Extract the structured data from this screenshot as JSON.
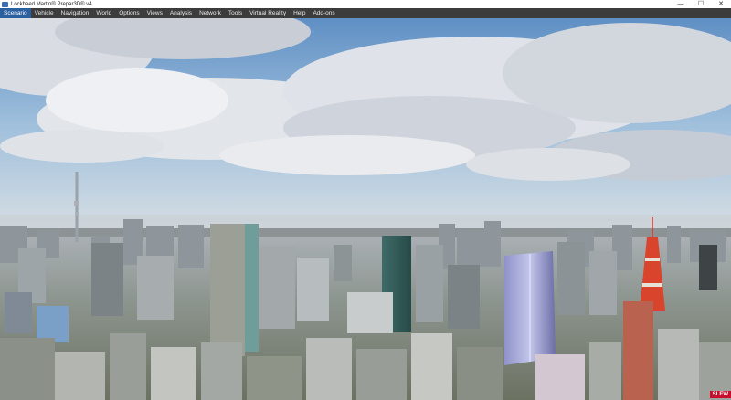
{
  "window": {
    "title": "Lockheed Martin® Prepar3D® v4",
    "controls": {
      "minimize": "—",
      "maximize": "☐",
      "close": "✕"
    }
  },
  "menu": [
    {
      "label": "Scenario",
      "active": true
    },
    {
      "label": "Vehicle"
    },
    {
      "label": "Navigation"
    },
    {
      "label": "World"
    },
    {
      "label": "Options"
    },
    {
      "label": "Views"
    },
    {
      "label": "Analysis"
    },
    {
      "label": "Network"
    },
    {
      "label": "Tools"
    },
    {
      "label": "Virtual Reality"
    },
    {
      "label": "Help"
    },
    {
      "label": "Add-ons"
    }
  ],
  "status": {
    "slew": "SLEW"
  },
  "colors": {
    "accent": "#2a5fa0",
    "slew": "#c8102e",
    "menubar": "#3c3c3c"
  }
}
